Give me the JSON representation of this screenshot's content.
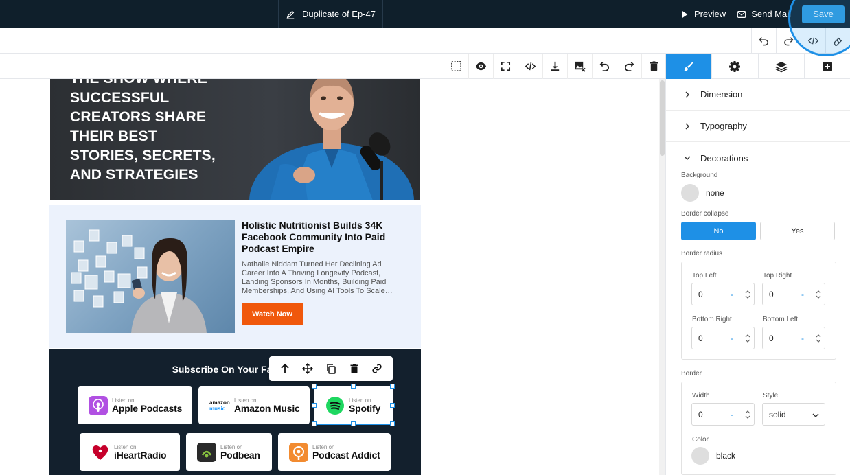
{
  "header": {
    "doc_title": "Duplicate of Ep-47",
    "preview_label": "Preview",
    "send_mail_label": "Send Mail",
    "save_label": "Save"
  },
  "hero": {
    "lines": [
      "THE SHOW WHERE",
      "SUCCESSFUL",
      "CREATORS SHARE",
      "THEIR BEST",
      "STORIES, SECRETS,",
      "AND STRATEGIES"
    ]
  },
  "feature": {
    "title": "Holistic Nutritionist Builds 34K Facebook Community Into Paid Podcast Empire",
    "description": "Nathalie Niddam Turned Her Declining Ad Career Into A Thriving Longevity Podcast, Landing Sponsors In Months, Building Paid Memberships, And Using AI Tools To Scale…",
    "button_label": "Watch Now"
  },
  "subscribe": {
    "title": "Subscribe On Your Favorite",
    "platforms": [
      {
        "small": "Listen on",
        "name": "Apple Podcasts",
        "color": "#b150e2"
      },
      {
        "small": "Listen on",
        "name": "Amazon Music",
        "prefix_top": "amazon",
        "prefix_bottom": "music",
        "color": "#1a98ff"
      },
      {
        "small": "Listen on",
        "name": "Spotify",
        "color": "#1ed760"
      },
      {
        "small": "Listen on",
        "name": "iHeartRadio",
        "color": "#c6002b"
      },
      {
        "small": "Listen on",
        "name": "Podbean",
        "color": "#2a2a2a"
      },
      {
        "small": "Listen on",
        "name": "Podcast Addict",
        "color": "#f28b30"
      }
    ]
  },
  "panel": {
    "sections": [
      "Dimension",
      "Typography",
      "Decorations"
    ],
    "background_label": "Background",
    "background_value": "none",
    "border_collapse_label": "Border collapse",
    "collapse_no": "No",
    "collapse_yes": "Yes",
    "border_radius_label": "Border radius",
    "top_left_label": "Top Left",
    "top_left_value": "0",
    "top_right_label": "Top Right",
    "top_right_value": "0",
    "bottom_right_label": "Bottom Right",
    "bottom_right_value": "0",
    "bottom_left_label": "Bottom Left",
    "bottom_left_value": "0",
    "dash": "-",
    "border_label": "Border",
    "width_label": "Width",
    "width_value": "0",
    "style_label": "Style",
    "style_value": "solid",
    "color_label": "Color",
    "color_value": "black"
  },
  "colors": {
    "accent": "#1e90e6",
    "topbar": "#0f1f2b",
    "cta": "#f0580c"
  }
}
